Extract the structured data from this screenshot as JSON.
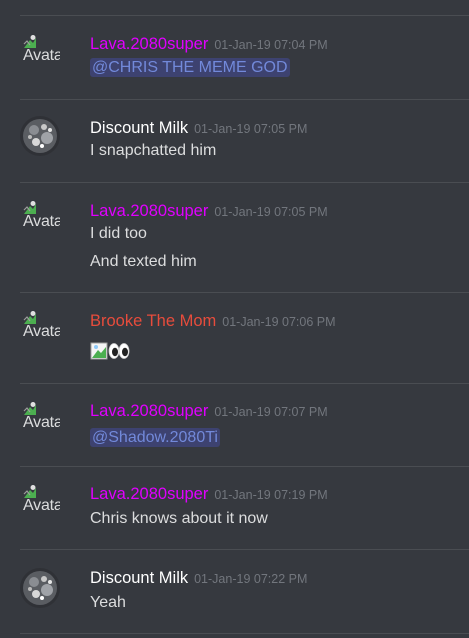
{
  "app": {
    "colors": {
      "background": "#36393f",
      "divider": "#4a4d52",
      "author_pink": "#e000ff",
      "author_white": "#ffffff",
      "author_red": "#e74c3c",
      "timestamp": "#72767d",
      "message_text": "#dcddde",
      "mention_text": "#7289da",
      "mention_bg": "#3d4270"
    }
  },
  "messages": [
    {
      "author": "Lava.2080super",
      "timestamp": "01-Jan-19 07:04 PM",
      "avatar_alt": "Avatar",
      "lines": [
        "@CHRIS THE MEME GOD"
      ]
    },
    {
      "author": "Discount Milk",
      "timestamp": "01-Jan-19 07:05 PM",
      "lines": [
        "I snapchatted him"
      ]
    },
    {
      "author": "Lava.2080super",
      "timestamp": "01-Jan-19 07:05 PM",
      "avatar_alt": "Avatar",
      "lines": [
        "I did too",
        "And texted him"
      ]
    },
    {
      "author": "Brooke The Mom",
      "timestamp": "01-Jan-19 07:06 PM",
      "avatar_alt": "Avatar",
      "content_icons": [
        "broken-image-icon",
        "eyes-emoji-icon"
      ]
    },
    {
      "author": "Lava.2080super",
      "timestamp": "01-Jan-19 07:07 PM",
      "avatar_alt": "Avatar",
      "lines": [
        "@Shadow.2080Ti"
      ]
    },
    {
      "author": "Lava.2080super",
      "timestamp": "01-Jan-19 07:19 PM",
      "avatar_alt": "Avatar",
      "lines": [
        "Chris knows about it now"
      ]
    },
    {
      "author": "Discount Milk",
      "timestamp": "01-Jan-19 07:22 PM",
      "lines": [
        "Yeah"
      ]
    }
  ]
}
